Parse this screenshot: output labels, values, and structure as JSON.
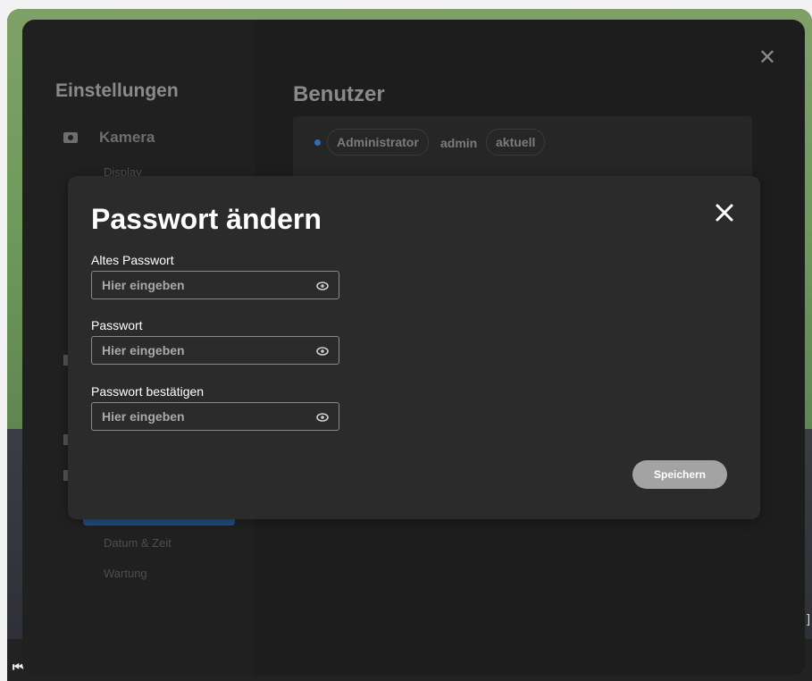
{
  "settings": {
    "sidebar_title": "Einstellungen",
    "camera_label": "Kamera",
    "camera_icon": "camera-icon",
    "sub_display": "Display",
    "sub_date_time": "Datum & Zeit",
    "sub_maintenance": "Wartung",
    "page_title": "Benutzer",
    "user_role": "Administrator",
    "user_name": "admin",
    "user_status": "aktuell",
    "close_icon": "close-icon"
  },
  "modal": {
    "title": "Passwort ändern",
    "close_icon": "close-icon",
    "fields": [
      {
        "label": "Altes Passwort",
        "placeholder": "Hier eingeben",
        "icon": "eye-icon"
      },
      {
        "label": "Passwort",
        "placeholder": "Hier eingeben",
        "icon": "eye-icon"
      },
      {
        "label": "Passwort bestätigen",
        "placeholder": "Hier eingeben",
        "icon": "eye-icon"
      }
    ],
    "save_label": "Speichern"
  },
  "colors": {
    "modal_bg": "#2b2b2b",
    "button_disabled": "#a3a3a3",
    "accent": "#1f4e86"
  }
}
